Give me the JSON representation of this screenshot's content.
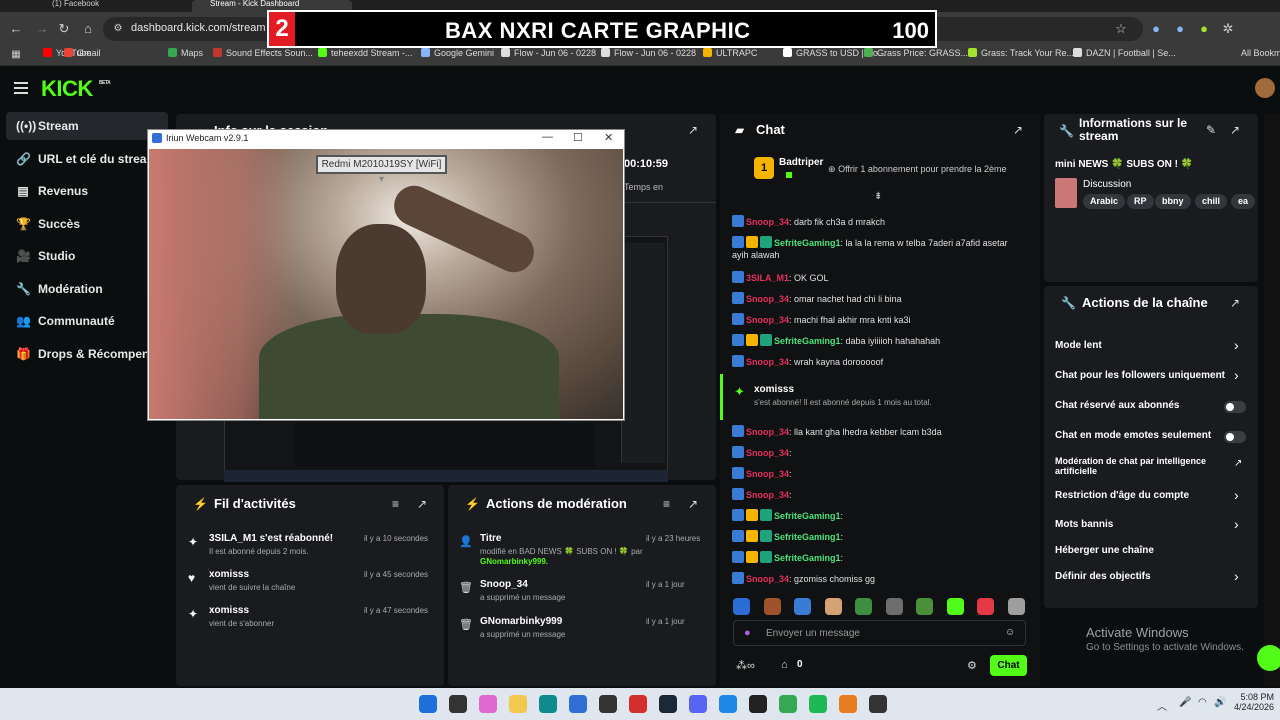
{
  "browser": {
    "tabs": [
      "(1) Facebook",
      "Stream - Kick Dashboard"
    ],
    "url": "dashboard.kick.com/stream",
    "bookmarks": [
      {
        "label": "YouTube",
        "color": "#ff0000"
      },
      {
        "label": "Gmail",
        "color": "#ea4335"
      },
      {
        "label": "Maps",
        "color": "#34a853"
      },
      {
        "label": "Sound Effects Soun...",
        "color": "#c0392b"
      },
      {
        "label": "teheexdd Stream -...",
        "color": "#53fc18"
      },
      {
        "label": "Google Gemini",
        "color": "#8ab4f8"
      },
      {
        "label": "Flow - Jun 06 - 0228",
        "color": "#dddddd"
      },
      {
        "label": "Flow - Jun 06 - 0228",
        "color": "#dddddd"
      },
      {
        "label": "ULTRAPC",
        "color": "#f4b400"
      },
      {
        "label": "GRASS to USD | Co...",
        "color": "#ffffff"
      },
      {
        "label": "Grass Price: GRASS...",
        "color": "#4caf50"
      },
      {
        "label": "Grass: Track Your Re...",
        "color": "#a4e22b"
      },
      {
        "label": "DAZN | Football | Se...",
        "color": "#dddddd"
      }
    ],
    "all_bookmarks": "All Bookm"
  },
  "banner": {
    "number": "2",
    "title": "BAX NXRI CARTE GRAPHIC",
    "count": "100"
  },
  "kick": {
    "logo": "KICK",
    "logo_beta": "BETA",
    "sidebar": [
      {
        "label": "Stream",
        "icon": "((•))"
      },
      {
        "label": "URL et clé du stream",
        "icon": "🔗"
      },
      {
        "label": "Revenus",
        "icon": "▤"
      },
      {
        "label": "Succès",
        "icon": "🏆"
      },
      {
        "label": "Studio",
        "icon": "🎥"
      },
      {
        "label": "Modération",
        "icon": "🔧"
      },
      {
        "label": "Communauté",
        "icon": "👥"
      },
      {
        "label": "Drops & Récompenses",
        "icon": "🎁"
      }
    ],
    "session": {
      "title": "Info sur la session",
      "time": "00:10:59",
      "time_label": "Temps en"
    }
  },
  "webcam": {
    "title": "Iriun Webcam v2.9.1",
    "device": "Redmi M2010J19SY [WiFi]"
  },
  "activity": {
    "title": "Fil d'activités",
    "items": [
      {
        "name": "3SILA_M1 s'est réabonné!",
        "sub": "Il est abonné depuis 2 mois.",
        "time": "il y a 10 secondes",
        "icon": "✦"
      },
      {
        "name": "xomisss",
        "sub": "vient de suivre la chaîne",
        "time": "il y a 45 secondes",
        "icon": "♥"
      },
      {
        "name": "xomisss",
        "sub": "vient de s'abonner",
        "time": "il y a 47 secondes",
        "icon": "✦"
      }
    ]
  },
  "moderation": {
    "title": "Actions de modération",
    "items": [
      {
        "name": "Titre",
        "sub": "modifié en BAD NEWS 🍀 SUBS ON ! 🍀 par",
        "sub2": "GNomarbinky999.",
        "time": "il y a 23 heures"
      },
      {
        "name": "Snoop_34",
        "sub": "a supprimé un message",
        "sub2": "",
        "time": "il y a 1 jour"
      },
      {
        "name": "GNomarbinky999",
        "sub": "a supprimé un message",
        "sub2": "",
        "time": "il y a 1 jour"
      }
    ]
  },
  "chat": {
    "title": "Chat",
    "pinned_user": "Badtriper",
    "pinned_rank": "1",
    "pinned_text": "Offrir 1 abonnement pour prendre la 2ème",
    "messages": [
      {
        "user": "Snoop_34",
        "text": ": darb fik ch3a d mrakch",
        "color": "red"
      },
      {
        "user": "SefriteGaming1",
        "text": ": la la la rema w telba 7aderi a7afid asetar",
        "color": "grn"
      },
      {
        "user": "",
        "text": "ayih alawah",
        "color": "grn"
      },
      {
        "user": "3SILA_M1",
        "text": ": OK GOL",
        "color": "red"
      },
      {
        "user": "Snoop_34",
        "text": ": omar nachet had chi li bina",
        "color": "red"
      },
      {
        "user": "Snoop_34",
        "text": ": machi fhal akhir mra knti ka3i",
        "color": "red"
      },
      {
        "user": "SefriteGaming1",
        "text": ": daba iyiiiioh hahahahah",
        "color": "grn"
      },
      {
        "user": "Snoop_34",
        "text": ": wrah kayna dorooooof",
        "color": "red"
      },
      {
        "user": "Snoop_34",
        "text": ": lla kant gha lhedra kebber lcam b3da",
        "color": "red"
      },
      {
        "user": "Snoop_34",
        "text": ":",
        "color": "red"
      },
      {
        "user": "Snoop_34",
        "text": ":",
        "color": "red"
      },
      {
        "user": "Snoop_34",
        "text": ":",
        "color": "red"
      },
      {
        "user": "SefriteGaming1",
        "text": ":",
        "color": "grn"
      },
      {
        "user": "SefriteGaming1",
        "text": ":",
        "color": "grn"
      },
      {
        "user": "SefriteGaming1",
        "text": ":",
        "color": "grn"
      },
      {
        "user": "Snoop_34",
        "text": ": gzomiss chomiss gg",
        "color": "red"
      }
    ],
    "sub_event": {
      "user": "xomisss",
      "text": "s'est abonné! Il est abonné depuis 1 mois au total."
    },
    "input_placeholder": "Envoyer un message",
    "send_label": "Chat",
    "count": "0"
  },
  "stream_info": {
    "title": "Informations sur le stream",
    "stream_title": "mini NEWS 🍀 SUBS ON ! 🍀",
    "category": "Discussion",
    "tags": [
      "Arabic",
      "RP",
      "bbny",
      "chill",
      "ea"
    ]
  },
  "channel_actions": {
    "title": "Actions de la chaîne",
    "items": [
      {
        "label": "Mode lent",
        "type": "chevron"
      },
      {
        "label": "Chat pour les followers uniquement",
        "type": "chevron"
      },
      {
        "label": "Chat réservé aux abonnés",
        "type": "toggle"
      },
      {
        "label": "Chat en mode emotes seulement",
        "type": "toggle"
      },
      {
        "label": "Modération de chat par intelligence",
        "label2": "artificielle",
        "type": "external"
      },
      {
        "label": "Restriction d'âge du compte",
        "type": "chevron"
      },
      {
        "label": "Mots bannis",
        "type": "chevron"
      },
      {
        "label": "Héberger une chaîne",
        "type": "none"
      },
      {
        "label": "Définir des objectifs",
        "type": "chevron"
      }
    ]
  },
  "windows": {
    "activate_title": "Activate Windows",
    "activate_sub": "Go to Settings to activate Windows.",
    "time": "5:08 PM",
    "date": "4/24/2026"
  },
  "colors": {
    "kick_green": "#53fc18",
    "panel": "#191b1f",
    "bg": "#0b0e0f",
    "banner_red": "#e31b23"
  }
}
